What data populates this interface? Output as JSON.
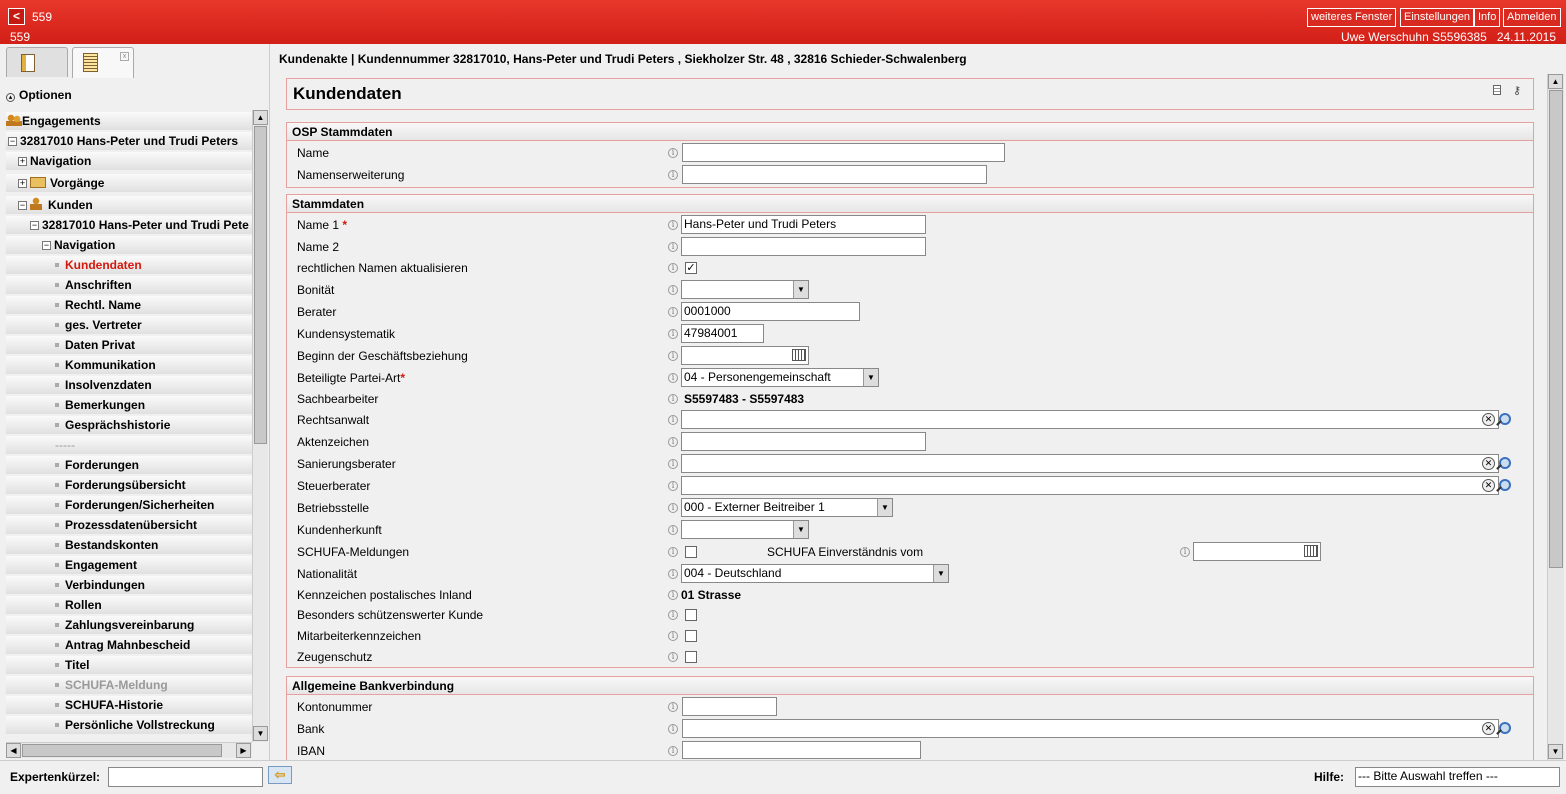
{
  "topbar": {
    "back": "<",
    "window_number": "559",
    "window_number2": "559",
    "buttons": {
      "more_window": "weiteres Fenster",
      "settings": "Einstellungen",
      "info": "Info",
      "logout": "Abmelden"
    },
    "user": "Uwe Werschuhn S5596385",
    "date": "24.11.2015"
  },
  "sidebar": {
    "options": "Optionen",
    "tree": [
      {
        "label": "Engagements"
      },
      {
        "label": "32817010 Hans-Peter und Trudi Peters"
      },
      {
        "label": "Navigation"
      },
      {
        "label": "Vorgänge"
      },
      {
        "label": "Kunden"
      },
      {
        "label": "32817010 Hans-Peter und Trudi Pete"
      },
      {
        "label": "Navigation"
      },
      {
        "label": "Kundendaten"
      },
      {
        "label": "Anschriften"
      },
      {
        "label": "Rechtl. Name"
      },
      {
        "label": "ges. Vertreter"
      },
      {
        "label": "Daten Privat"
      },
      {
        "label": "Kommunikation"
      },
      {
        "label": "Insolvenzdaten"
      },
      {
        "label": "Bemerkungen"
      },
      {
        "label": "Gesprächshistorie"
      },
      {
        "label": "-----"
      },
      {
        "label": "Forderungen"
      },
      {
        "label": "Forderungsübersicht"
      },
      {
        "label": "Forderungen/Sicherheiten"
      },
      {
        "label": "Prozessdatenübersicht"
      },
      {
        "label": "Bestandskonten"
      },
      {
        "label": "Engagement"
      },
      {
        "label": "Verbindungen"
      },
      {
        "label": "Rollen"
      },
      {
        "label": "Zahlungsvereinbarung"
      },
      {
        "label": "Antrag Mahnbescheid"
      },
      {
        "label": "Titel"
      },
      {
        "label": "SCHUFA-Meldung"
      },
      {
        "label": "SCHUFA-Historie"
      },
      {
        "label": "Persönliche Vollstreckung"
      }
    ]
  },
  "main": {
    "breadcrumb": "Kundenakte | Kundennummer 32817010, Hans-Peter und Trudi Peters , Siekholzer Str. 48 , 32816 Schieder-Schwalenberg",
    "title": "Kundendaten",
    "osp": {
      "heading": "OSP Stammdaten",
      "name_label": "Name",
      "name_ext_label": "Namenserweiterung"
    },
    "stamm": {
      "heading": "Stammdaten",
      "name1_label": "Name 1",
      "name1_value": "Hans-Peter und Trudi Peters",
      "name2_label": "Name 2",
      "rechtl_label": "rechtlichen Namen aktualisieren",
      "rechtl_check": "✓",
      "bonitaet_label": "Bonität",
      "berater_label": "Berater",
      "berater_value": "0001000",
      "systematik_label": "Kundensystematik",
      "systematik_value": "47984001",
      "beginn_label": "Beginn der Geschäftsbeziehung",
      "partei_label": "Beteiligte Partei-Art",
      "partei_value": "04 - Personengemeinschaft",
      "sachbearbeiter_label": "Sachbearbeiter",
      "sachbearbeiter_value": "S5597483 - S5597483",
      "rechtsanwalt_label": "Rechtsanwalt",
      "aktenzeichen_label": "Aktenzeichen",
      "sanierung_label": "Sanierungsberater",
      "steuer_label": "Steuerberater",
      "betrieb_label": "Betriebsstelle",
      "betrieb_value": "000 - Externer Beitreiber 1",
      "herkunft_label": "Kundenherkunft",
      "schufa_label": "SCHUFA-Meldungen",
      "schufa_einv_label": "SCHUFA Einverständnis vom",
      "nation_label": "Nationalität",
      "nation_value": "004 - Deutschland",
      "kennz_label": "Kennzeichen postalisches Inland",
      "kennz_value": "01 Strasse",
      "schuetz_label": "Besonders schützenswerter Kunde",
      "mitarbeiter_label": "Mitarbeiterkennzeichen",
      "zeugen_label": "Zeugenschutz"
    },
    "bank": {
      "heading": "Allgemeine Bankverbindung",
      "konto_label": "Kontonummer",
      "bank_label": "Bank",
      "iban_label": "IBAN"
    }
  },
  "bottom": {
    "expert_label": "Expertenkürzel:",
    "help_label": "Hilfe:",
    "help_value": "--- Bitte Auswahl treffen ---"
  }
}
